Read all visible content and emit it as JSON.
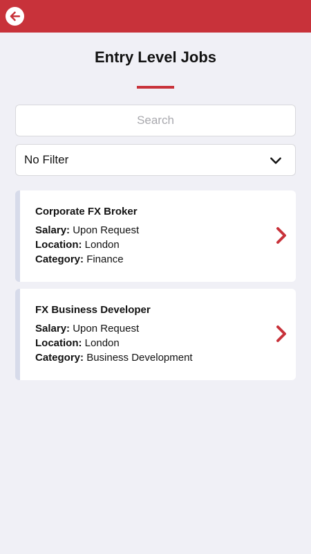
{
  "header": {
    "title": "Entry Level Jobs",
    "accent_color": "#c8323a"
  },
  "search": {
    "placeholder": "Search",
    "value": ""
  },
  "filter": {
    "selected": "No Filter"
  },
  "jobs": [
    {
      "title": "Corporate FX Broker",
      "salary_label": "Salary:",
      "salary": "Upon Request",
      "location_label": "Location:",
      "location": "London",
      "category_label": "Category:",
      "category": "Finance"
    },
    {
      "title": "FX Business Developer",
      "salary_label": "Salary:",
      "salary": "Upon Request",
      "location_label": "Location:",
      "location": "London",
      "category_label": "Category:",
      "category": "Business Development"
    }
  ],
  "icons": {
    "back": "arrow-left-circle-icon",
    "filter": "chevron-down-icon",
    "card": "chevron-right-icon"
  }
}
